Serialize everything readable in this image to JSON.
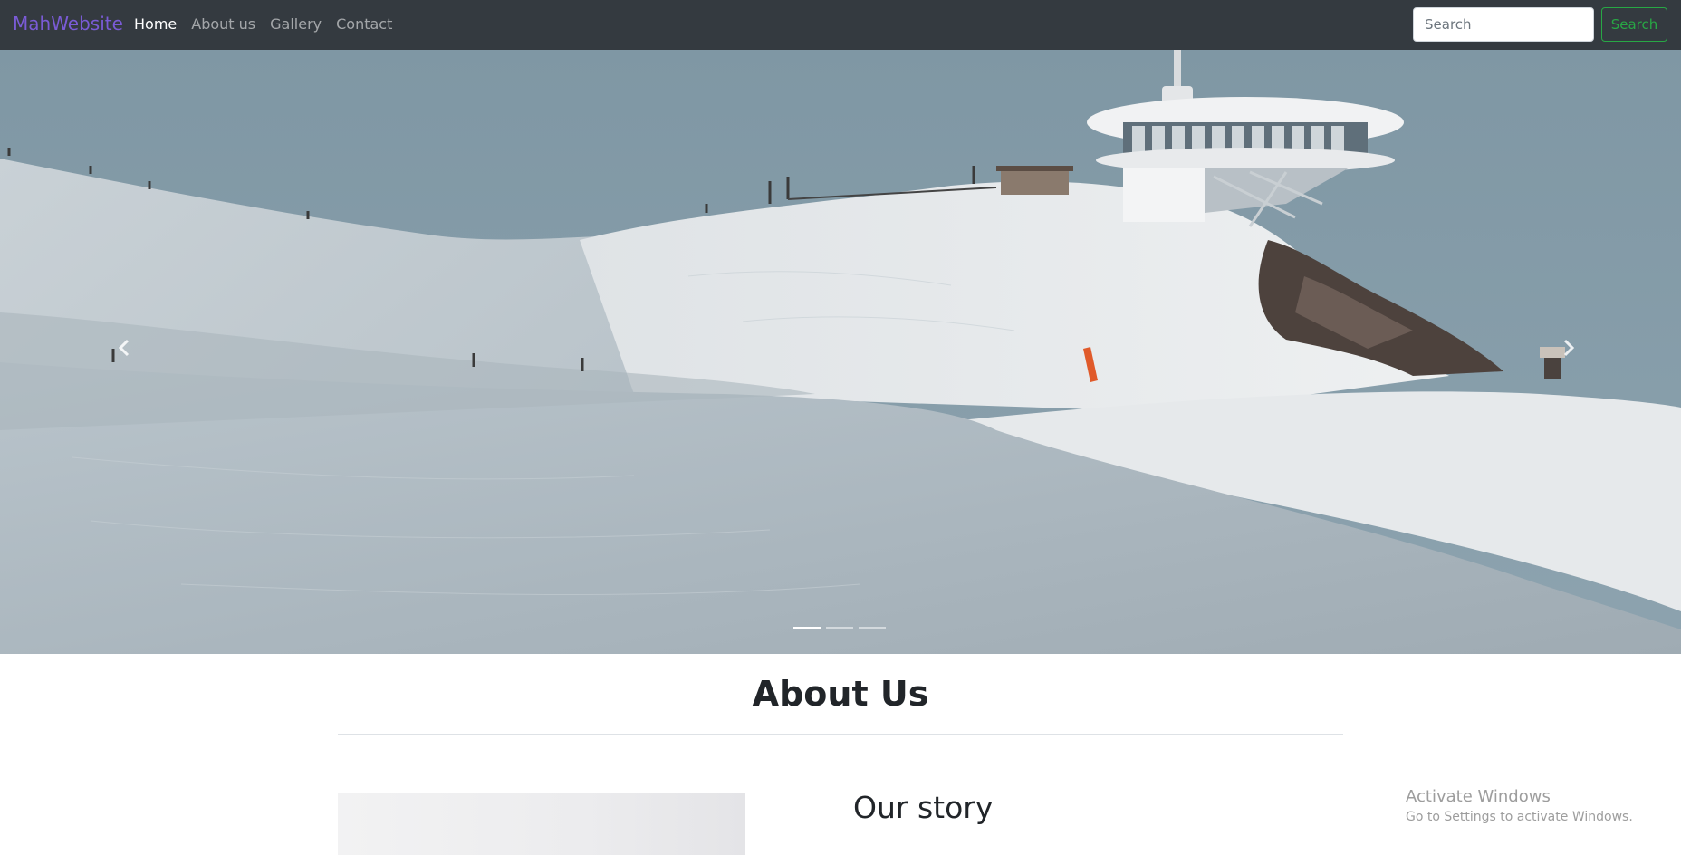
{
  "navbar": {
    "brand": "MahWebsite",
    "links": [
      {
        "label": "Home",
        "active": true
      },
      {
        "label": "About us",
        "active": false
      },
      {
        "label": "Gallery",
        "active": false
      },
      {
        "label": "Contact",
        "active": false
      }
    ],
    "search": {
      "placeholder": "Search",
      "button_label": "Search"
    }
  },
  "carousel": {
    "slide_count": 3,
    "active_slide": 1,
    "prev_icon": "chevron-left-icon",
    "next_icon": "chevron-right-icon",
    "image_subject": "snowy-mountain-with-rotating-restaurant"
  },
  "about": {
    "title": "About Us",
    "story_title": "Our story"
  },
  "watermark": {
    "title": "Activate Windows",
    "subtitle": "Go to Settings to activate Windows."
  },
  "colors": {
    "navbar_bg": "#343a40",
    "brand": "#7a5bd6",
    "search_button": "#28a745"
  }
}
